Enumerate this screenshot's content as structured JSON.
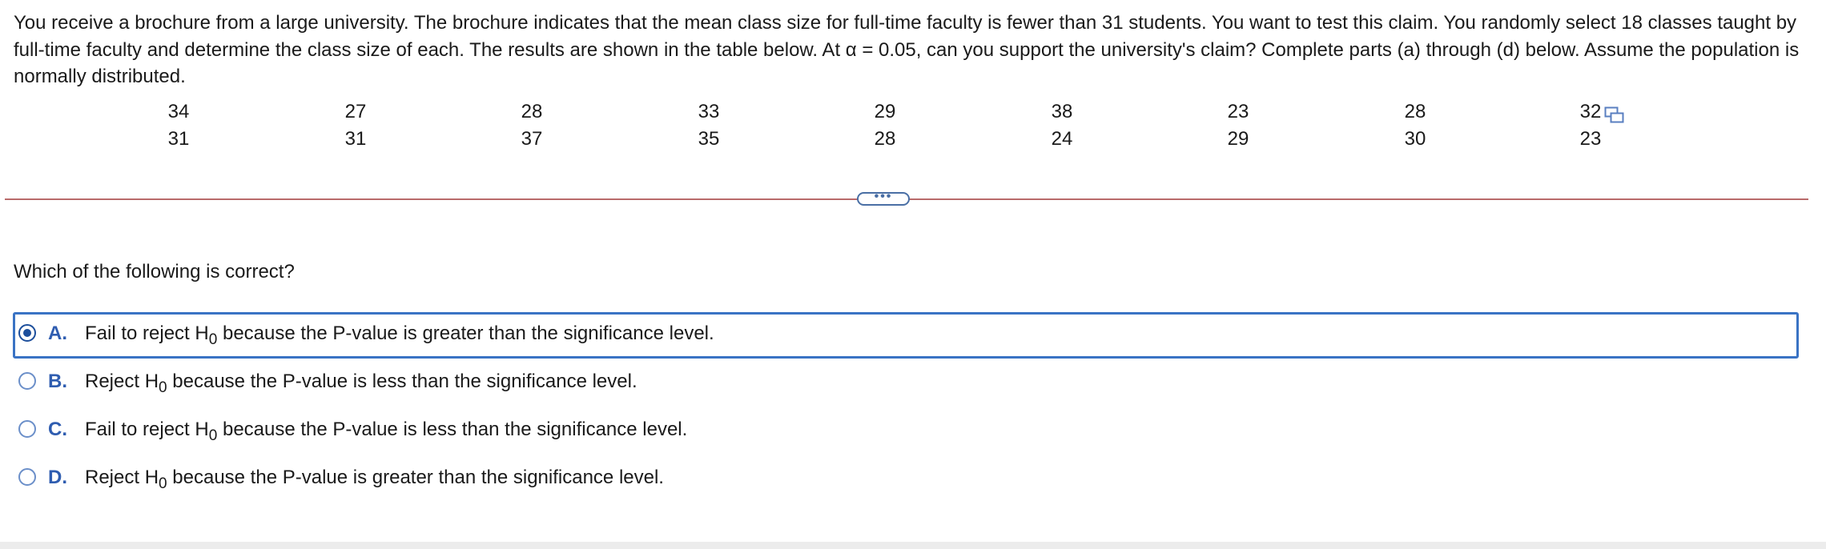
{
  "problem": {
    "text": "You receive a brochure from a large university. The brochure indicates that the mean class size for full-time faculty is fewer than 31 students. You want to test this claim. You randomly select 18 classes taught by full-time faculty and determine the class size of each. The results are shown in the table below. At α = 0.05, can you support the university's claim? Complete parts (a) through (d) below. Assume the population is normally distributed."
  },
  "data_table": {
    "rows": [
      [
        "34",
        "27",
        "28",
        "33",
        "29",
        "38",
        "23",
        "28",
        "32"
      ],
      [
        "31",
        "31",
        "37",
        "35",
        "28",
        "24",
        "29",
        "30",
        "23"
      ]
    ]
  },
  "toolbar": {
    "expand_label": "•••"
  },
  "question": {
    "text": "Which of the following is correct?"
  },
  "choices": [
    {
      "letter": "A.",
      "pre": "Fail to reject H",
      "sub": "0",
      "post": " because the P-value is greater than the significance level.",
      "selected": true
    },
    {
      "letter": "B.",
      "pre": "Reject H",
      "sub": "0",
      "post": " because the P-value is less than the significance level.",
      "selected": false
    },
    {
      "letter": "C.",
      "pre": "Fail to reject H",
      "sub": "0",
      "post": " because the P-value is less than the significance level.",
      "selected": false
    },
    {
      "letter": "D.",
      "pre": "Reject H",
      "sub": "0",
      "post": " because the P-value is greater than the significance level.",
      "selected": false
    }
  ],
  "colors": {
    "accent": "#3a73c4",
    "choice_letter": "#2f5db0",
    "divider": "#b96a6a"
  },
  "icons": {
    "copy": "copy-data-icon",
    "radio": "radio-button-icon"
  }
}
